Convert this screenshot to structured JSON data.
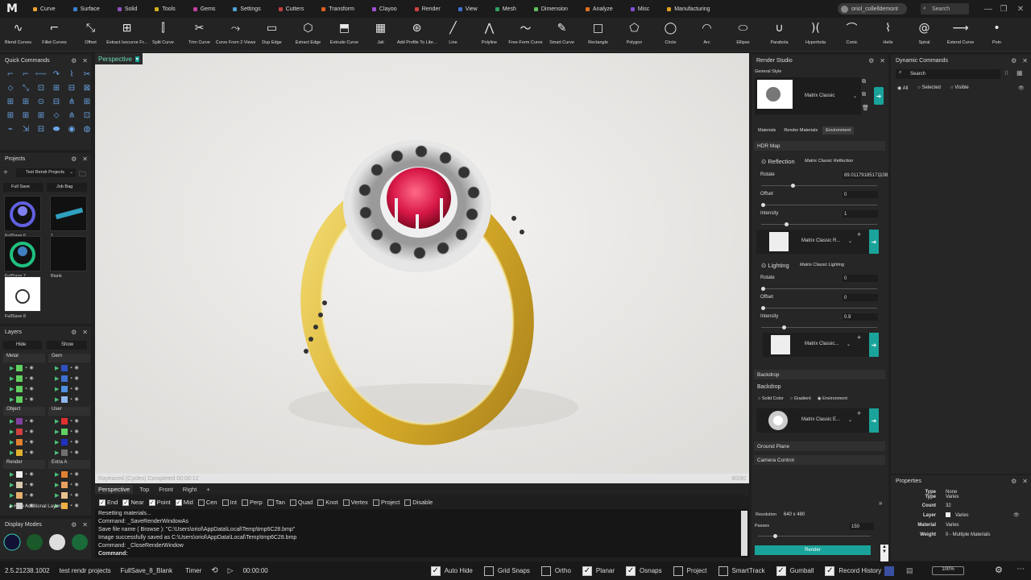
{
  "menu": {
    "logo": "M",
    "tabs": [
      {
        "label": "Curve",
        "color": "#e8a030"
      },
      {
        "label": "Surface",
        "color": "#3a80d0"
      },
      {
        "label": "Solid",
        "color": "#9050c0"
      },
      {
        "label": "Tools",
        "color": "#d0b020"
      },
      {
        "label": "Gems",
        "color": "#c040a0"
      },
      {
        "label": "Settings",
        "color": "#50a0d0"
      },
      {
        "label": "Cutters",
        "color": "#c04040"
      },
      {
        "label": "Transform",
        "color": "#e06020"
      },
      {
        "label": "Clayoo",
        "color": "#a050d0"
      },
      {
        "label": "Render",
        "color": "#d04040"
      },
      {
        "label": "View",
        "color": "#4070d0"
      },
      {
        "label": "Mesh",
        "color": "#30a060"
      },
      {
        "label": "Dimension",
        "color": "#60c060"
      },
      {
        "label": "Analyze",
        "color": "#e07020"
      },
      {
        "label": "Misc",
        "color": "#8050d0"
      },
      {
        "label": "Manufacturing",
        "color": "#e0a020"
      }
    ],
    "user": "oriol_collelldemont",
    "search": "Search"
  },
  "toolbar": [
    {
      "icon": "curve-icon",
      "glyph": "∿",
      "label": "Blend Curves"
    },
    {
      "icon": "fillet-icon",
      "glyph": "⌐",
      "label": "Fillet Curves"
    },
    {
      "icon": "offset-icon",
      "glyph": "⤡",
      "label": "Offset"
    },
    {
      "icon": "isocurve-icon",
      "glyph": "⊞",
      "label": "Extract Isocurve Fr..."
    },
    {
      "icon": "split-icon",
      "glyph": "⫿",
      "label": "Split Curve"
    },
    {
      "icon": "trim-icon",
      "glyph": "✂",
      "label": "Trim Curve"
    },
    {
      "icon": "two-views-icon",
      "glyph": "⤳",
      "label": "Curve From 2 Views"
    },
    {
      "icon": "dup-edge-icon",
      "glyph": "▭",
      "label": "Dup Edge"
    },
    {
      "icon": "extract-edge-icon",
      "glyph": "⬡",
      "label": "Extract Edge"
    },
    {
      "icon": "extrude-icon",
      "glyph": "⬒",
      "label": "Extrude Curve"
    },
    {
      "icon": "jali-icon",
      "glyph": "▦",
      "label": "Jali"
    },
    {
      "icon": "profile-icon",
      "glyph": "⊛",
      "label": "Add Profile To Libr..."
    },
    {
      "icon": "line-icon",
      "glyph": "╱",
      "label": "Line"
    },
    {
      "icon": "polyline-icon",
      "glyph": "⋀",
      "label": "Polyline"
    },
    {
      "icon": "freeform-icon",
      "glyph": "〜",
      "label": "Free-Form Curve"
    },
    {
      "icon": "smart-curve-icon",
      "glyph": "✎",
      "label": "Smart Curve"
    },
    {
      "icon": "rectangle-icon",
      "glyph": "□",
      "label": "Rectangle"
    },
    {
      "icon": "polygon-icon",
      "glyph": "⬠",
      "label": "Polygon"
    },
    {
      "icon": "circle-icon",
      "glyph": "◯",
      "label": "Circle"
    },
    {
      "icon": "arc-icon",
      "glyph": "◠",
      "label": "Arc"
    },
    {
      "icon": "ellipse-icon",
      "glyph": "⬭",
      "label": "Ellipse"
    },
    {
      "icon": "parabola-icon",
      "glyph": "∪",
      "label": "Parabola"
    },
    {
      "icon": "hyperbola-icon",
      "glyph": ")(",
      "label": "Hyperbola"
    },
    {
      "icon": "conic-icon",
      "glyph": "⌒",
      "label": "Conic"
    },
    {
      "icon": "helix-icon",
      "glyph": "⌇",
      "label": "Helix"
    },
    {
      "icon": "spiral-icon",
      "glyph": "@",
      "label": "Spiral"
    },
    {
      "icon": "extend-icon",
      "glyph": "⟶",
      "label": "Extend Curve"
    },
    {
      "icon": "point-icon",
      "glyph": "•",
      "label": "Poin"
    }
  ],
  "quick": {
    "title": "Quick Commands",
    "glyphs": [
      "⌐",
      "⌐",
      "⬳",
      "↷",
      "⌇",
      "✂",
      "⬦",
      "⤡",
      "⊡",
      "⊞",
      "⊟",
      "⊠",
      "⊞",
      "⊞",
      "⊙",
      "⊟",
      "⋔",
      "⊞",
      "⊞",
      "⊞",
      "⊞",
      "⬦",
      "⋔",
      "⊡",
      "⌁",
      "⇲",
      "⊟",
      "⬬",
      "◉",
      "◍"
    ]
  },
  "projects": {
    "title": "Projects",
    "selector": "Test Rendr Projects",
    "full_save": "Full Save",
    "job_bag": "Job Bag",
    "items": [
      "FullSave 6",
      "1",
      "FullSave 7",
      "Blank",
      "FullSave 8"
    ]
  },
  "layers": {
    "title": "Layers",
    "hide": "Hide",
    "show": "Show",
    "groups": [
      {
        "name": "Metal",
        "colors": [
          "#60d060",
          "#60d060",
          "#60d060",
          "#60d060"
        ]
      },
      {
        "name": "Gem",
        "colors": [
          "#3050c0",
          "#4070d0",
          "#5090e0",
          "#90b8f0"
        ]
      },
      {
        "name": "Object",
        "colors": [
          "#8040a0",
          "#d04040",
          "#e08030",
          "#e0b030"
        ]
      },
      {
        "name": "User",
        "colors": [
          "#e03030",
          "#60d060",
          "#2030c0",
          "#707070"
        ]
      },
      {
        "name": "Render",
        "colors": [
          "#f0f0f0",
          "#d8c8b0",
          "#e8b070",
          "#c8c8c8"
        ]
      },
      {
        "name": "Extra A",
        "colors": [
          "#e08030",
          "#e8a060",
          "#e8c090",
          "#f0b040"
        ]
      }
    ],
    "additional": "Hide Additional Layers"
  },
  "display": {
    "title": "Display Modes"
  },
  "viewport": {
    "name": "Perspective",
    "status": "Raytraced (Cycles)   Completed    00:00:12",
    "passes_done": "80/80"
  },
  "viewtabs": [
    "Perspective",
    "Top",
    "Front",
    "Right",
    "+"
  ],
  "snaps": [
    {
      "label": "End",
      "on": true
    },
    {
      "label": "Near",
      "on": true
    },
    {
      "label": "Point",
      "on": true
    },
    {
      "label": "Mid",
      "on": true
    },
    {
      "label": "Cen",
      "on": false
    },
    {
      "label": "Int",
      "on": false
    },
    {
      "label": "Perp",
      "on": false
    },
    {
      "label": "Tan",
      "on": false
    },
    {
      "label": "Quad",
      "on": false
    },
    {
      "label": "Knot",
      "on": false
    },
    {
      "label": "Vertex",
      "on": false
    },
    {
      "label": "Project",
      "on": false
    },
    {
      "label": "Disable",
      "on": false
    }
  ],
  "command": {
    "lines": [
      "Resetting materials...",
      "Command: _SaveRenderWindowAs",
      "Save file name ( Browse ): \"C:\\Users\\oriol\\AppData\\Local\\Temp\\tmp6C28.bmp\"",
      "Image successfully saved as C:\\Users\\oriol\\AppData\\Local\\Temp\\tmp6C28.bmp",
      "Command: _CloseRenderWindow"
    ],
    "prompt": "Command:"
  },
  "bottom": {
    "version": "2.5.21238.1002",
    "project": "test rendr projects",
    "file": "FullSave_8_Blank",
    "timer": "Timer",
    "time": "00:00:00",
    "toggles": [
      {
        "label": "Auto Hide",
        "on": true
      },
      {
        "label": "Grid Snaps",
        "on": false
      },
      {
        "label": "Ortho",
        "on": false
      },
      {
        "label": "Planar",
        "on": true
      },
      {
        "label": "Osnaps",
        "on": true
      },
      {
        "label": "Project",
        "on": false
      },
      {
        "label": "SmartTrack",
        "on": false
      },
      {
        "label": "Gumball",
        "on": true
      },
      {
        "label": "Record History",
        "on": true
      }
    ],
    "zoom": "100%"
  },
  "render": {
    "title": "Render Studio",
    "general": "General Style",
    "style": "Matrix Classic",
    "tabs": [
      "Materials",
      "Render Materials",
      "Environment"
    ],
    "hdr": "HDR Map",
    "reflection": "Reflection",
    "reflection_name": "Matrix Classic Reflection",
    "rotate": "Rotate",
    "offset": "Offset",
    "intensity": "Intensity",
    "refl_rotate": "89.01179185171108",
    "refl_offset": "0",
    "refl_intensity": "1",
    "refl_mat": "Matrix Classic R...",
    "lighting": "Lighting",
    "lighting_name": "Matrix Classic Lighting",
    "light_rotate": "0",
    "light_offset": "0",
    "light_intensity": "0.9",
    "light_mat": "Matrix Classic...",
    "backdrop_sec": "Backdrop",
    "backdrop": "Backdrop",
    "bd_opts": [
      "Solid Color",
      "Gradient",
      "Environment"
    ],
    "bd_mat": "Matrix Classic E...",
    "ground": "Ground Plane",
    "camera": "Camera Control",
    "resolution_label": "Resolution",
    "resolution": "640 x 480",
    "passes_label": "Passes",
    "passes": "150",
    "render_btn": "Render"
  },
  "dynamic": {
    "title": "Dynamic Commands",
    "search": "Search",
    "filters": [
      "All",
      "Selected",
      "Visible"
    ]
  },
  "properties": {
    "title": "Properties",
    "type_label": "Type",
    "type_val": "None",
    "type2_label": "Type",
    "type2_val": "Varies",
    "count_label": "Count",
    "count": "32",
    "layer_label": "Layer",
    "layer": "Varies",
    "material_label": "Material",
    "material": "Varies",
    "weight_label": "Weight",
    "weight": "0 - Multiple Materials"
  }
}
